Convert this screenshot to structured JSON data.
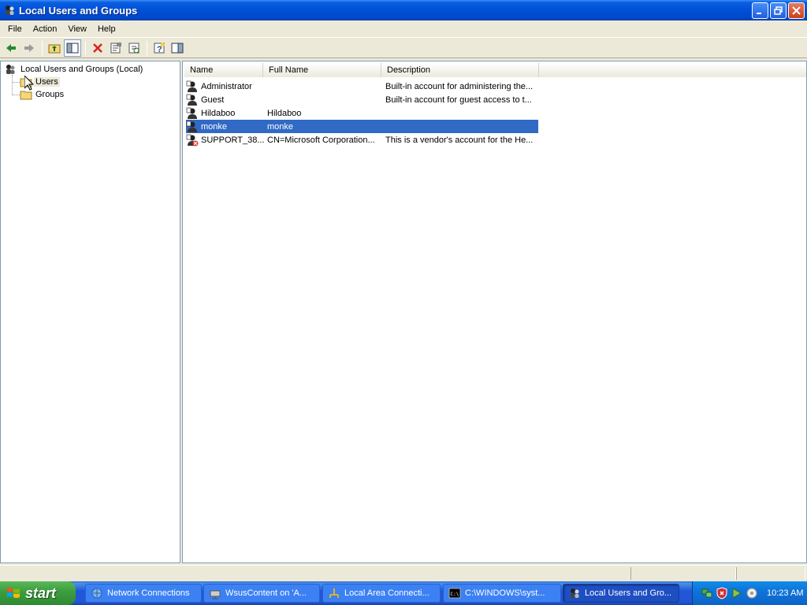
{
  "window": {
    "title": "Local Users and Groups"
  },
  "menu": [
    "File",
    "Action",
    "View",
    "Help"
  ],
  "tree": {
    "root": "Local Users and Groups (Local)",
    "children": [
      "Users",
      "Groups"
    ]
  },
  "list": {
    "columns": [
      "Name",
      "Full Name",
      "Description"
    ],
    "rows": [
      {
        "name": "Administrator",
        "full_name": "",
        "description": "Built-in account for administering the...",
        "icon": "user-icon",
        "selected": false
      },
      {
        "name": "Guest",
        "full_name": "",
        "description": "Built-in account for guest access to t...",
        "icon": "user-icon",
        "selected": false
      },
      {
        "name": "Hildaboo",
        "full_name": "Hildaboo",
        "description": "",
        "icon": "user-icon",
        "selected": false
      },
      {
        "name": "monke",
        "full_name": "monke",
        "description": "",
        "icon": "user-icon",
        "selected": true
      },
      {
        "name": "SUPPORT_38...",
        "full_name": "CN=Microsoft Corporation...",
        "description": "This is a vendor's account for the He...",
        "icon": "disabled-user-icon",
        "selected": false
      }
    ]
  },
  "taskbar": {
    "start_label": "start",
    "items": [
      {
        "label": "Network Connections",
        "icon": "network-connections-icon",
        "active": false
      },
      {
        "label": "WsusContent on 'A...",
        "icon": "network-drive-icon",
        "active": false
      },
      {
        "label": "Local Area Connecti...",
        "icon": "local-area-connection-icon",
        "active": false
      },
      {
        "label": "C:\\WINDOWS\\syst...",
        "icon": "command-prompt-icon",
        "active": false
      },
      {
        "label": "Local Users and Gro...",
        "icon": "users-groups-icon",
        "active": true
      }
    ],
    "tray_icons": [
      "network-tray-icon",
      "security-shield-icon",
      "updates-icon",
      "volume-icon"
    ],
    "clock": "10:23 AM"
  },
  "colors": {
    "selection": "#316ac5",
    "titlebar": "#0050d6",
    "taskbar": "#2157d7",
    "start": "#3e9e40"
  }
}
